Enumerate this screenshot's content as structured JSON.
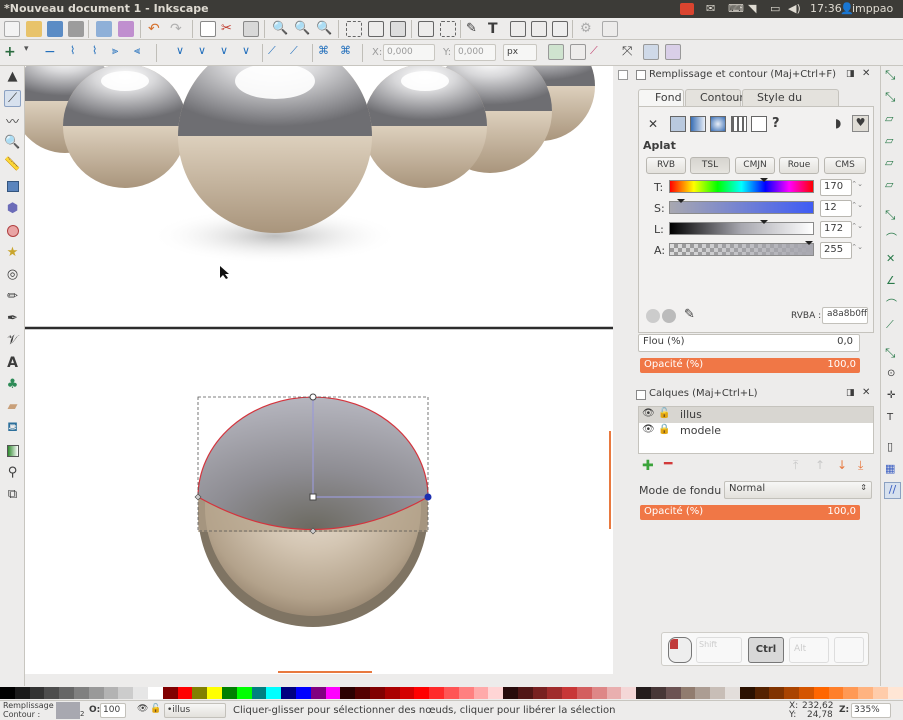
{
  "window": {
    "title": "*Nouveau document 1 - Inkscape",
    "time": "17:36",
    "user": "imppao"
  },
  "tool_controls": {
    "x_label": "X:",
    "x_value": "0,000",
    "y_label": "Y:",
    "y_value": "0,000",
    "unit": "px"
  },
  "fill_stroke_panel": {
    "title": "Remplissage et contour (Maj+Ctrl+F)",
    "tabs": [
      "Fond",
      "Contour",
      "Style du contour"
    ],
    "paint_type": "Aplat",
    "mode_buttons": [
      "RVB",
      "TSL",
      "CMJN",
      "Roue",
      "CMS"
    ],
    "active_mode": "TSL",
    "channels": [
      {
        "label": "T:",
        "value": "170",
        "fraction": 0.67
      },
      {
        "label": "S:",
        "value": "12",
        "fraction": 0.05
      },
      {
        "label": "L:",
        "value": "172",
        "fraction": 0.67
      },
      {
        "label": "A:",
        "value": "255",
        "fraction": 1.0
      }
    ],
    "rgba_label": "RVBA :",
    "rgba_value": "a8a8b0ff",
    "blur_label": "Flou (%)",
    "blur_value": "0,0",
    "opacity_label": "Opacité (%)",
    "opacity_value": "100,0"
  },
  "layers_panel": {
    "title": "Calques (Maj+Ctrl+L)",
    "layers": [
      {
        "name": "illus",
        "selected": true
      },
      {
        "name": "modele",
        "selected": false
      }
    ],
    "blend_label": "Mode de fondu :",
    "blend_value": "Normal",
    "opacity_label": "Opacité (%)",
    "opacity_value": "100,0"
  },
  "key_indicator": {
    "keys": [
      "Shift",
      "Ctrl",
      "Alt",
      ""
    ],
    "active": "Ctrl"
  },
  "status": {
    "fill_label": "Remplissage :",
    "stroke_label": "Contour :",
    "stroke_width": "2",
    "o_label": "O:",
    "o_value": "100",
    "layer": "•illus",
    "message": "Cliquer-glisser pour sélectionner des nœuds, cliquer pour libérer la sélection",
    "x_label": "X:",
    "x_value": "232,62",
    "y_label": "Y:",
    "y_value": "24,78",
    "z_label": "Z:",
    "zoom": "335%"
  },
  "colors": {
    "accent": "#f07746",
    "selection_red": "#d4343d",
    "palette": [
      "#000000",
      "#1a1a1a",
      "#333333",
      "#4d4d4d",
      "#666666",
      "#808080",
      "#999999",
      "#b3b3b3",
      "#cccccc",
      "#e6e6e6",
      "#ffffff",
      "#800000",
      "#ff0000",
      "#808000",
      "#ffff00",
      "#008000",
      "#00ff00",
      "#008080",
      "#00ffff",
      "#000080",
      "#0000ff",
      "#800080",
      "#ff00ff",
      "#2b0000",
      "#550000",
      "#800000",
      "#aa0000",
      "#d40000",
      "#ff0000",
      "#ff2a2a",
      "#ff5555",
      "#ff8080",
      "#ffaaaa",
      "#ffd5d5",
      "#280b0b",
      "#501616",
      "#782121",
      "#a02c2c",
      "#c83737",
      "#d35f5f",
      "#de8787",
      "#e9afaf",
      "#f4d7d7",
      "#241c1c",
      "#483737",
      "#6c5353",
      "#917c6f",
      "#ac9d93",
      "#c8beb7",
      "#e3dedb",
      "#2b1100",
      "#552200",
      "#803300",
      "#aa4400",
      "#d45500",
      "#ff6600",
      "#ff7f2a",
      "#ff9955",
      "#ffb380",
      "#ffccaa",
      "#ffe6d5"
    ]
  }
}
